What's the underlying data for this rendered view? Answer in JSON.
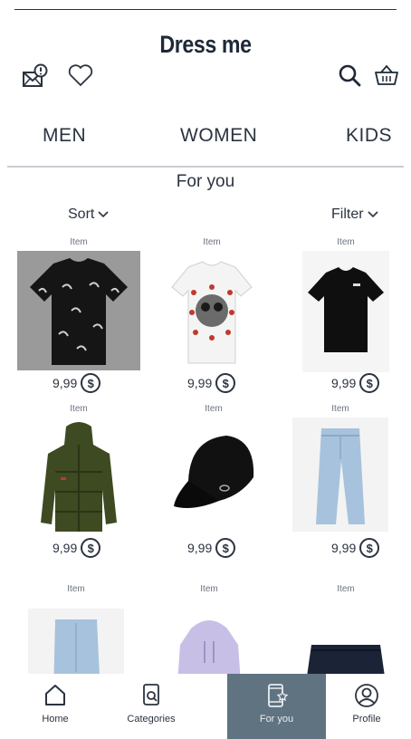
{
  "header": {
    "title": "Dress me",
    "icons": [
      "mail-alert-icon",
      "heart-icon",
      "search-icon",
      "basket-icon"
    ]
  },
  "tabs": [
    "MEN",
    "WOMEN",
    "KIDS"
  ],
  "section_title": "For you",
  "controls": {
    "sort_label": "Sort",
    "filter_label": "Filter"
  },
  "products": [
    {
      "label": "Item",
      "price": "9,99",
      "image": "black-patterned-tshirt"
    },
    {
      "label": "Item",
      "price": "9,99",
      "image": "white-skull-tshirt"
    },
    {
      "label": "Item",
      "price": "9,99",
      "image": "black-tshirt"
    },
    {
      "label": "Item",
      "price": "9,99",
      "image": "olive-puffer-jacket"
    },
    {
      "label": "Item",
      "price": "9,99",
      "image": "black-cap"
    },
    {
      "label": "Item",
      "price": "9,99",
      "image": "light-blue-jeans"
    },
    {
      "label": "Item",
      "image": "light-blue-jeans"
    },
    {
      "label": "Item",
      "image": "lavender-hoodie"
    },
    {
      "label": "Item",
      "image": "navy-shorts"
    }
  ],
  "currency_symbol": "$",
  "bottom_nav": [
    {
      "label": "Home",
      "icon": "home-icon"
    },
    {
      "label": "Categories",
      "icon": "categories-icon"
    },
    {
      "label": "For you",
      "icon": "phone-star-icon",
      "active": true
    },
    {
      "label": "Profile",
      "icon": "profile-icon"
    }
  ],
  "colors": {
    "text": "#2b3340",
    "active_nav_bg": "#5f7380",
    "divider": "#c9ccd1"
  }
}
